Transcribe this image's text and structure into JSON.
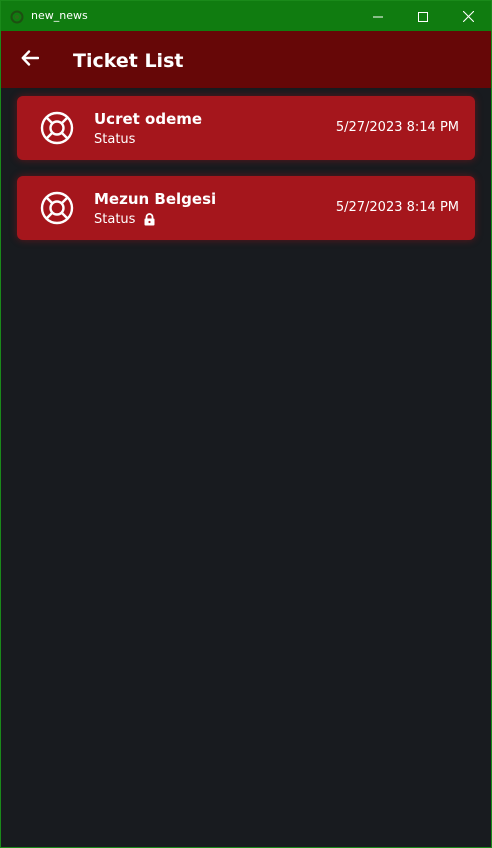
{
  "window": {
    "title": "new_news",
    "app_icon": "app-logo-icon",
    "controls": {
      "minimize_icon": "minimize-icon",
      "maximize_icon": "maximize-icon",
      "close_icon": "close-icon"
    },
    "titlebar_color": "#107c10"
  },
  "appbar": {
    "back_icon": "arrow-left-icon",
    "title": "Ticket List",
    "background": "#660707"
  },
  "tickets": [
    {
      "icon": "lifebuoy-icon",
      "title": "Ucret odeme",
      "status_label": "Status",
      "locked": false,
      "date": "5/27/2023 8:14 PM"
    },
    {
      "icon": "lifebuoy-icon",
      "title": "Mezun Belgesi",
      "status_label": "Status",
      "locked": true,
      "date": "5/27/2023 8:14 PM"
    }
  ],
  "colors": {
    "card": "#a5161c",
    "page_background": "#181b1f",
    "text": "#ffffff"
  }
}
